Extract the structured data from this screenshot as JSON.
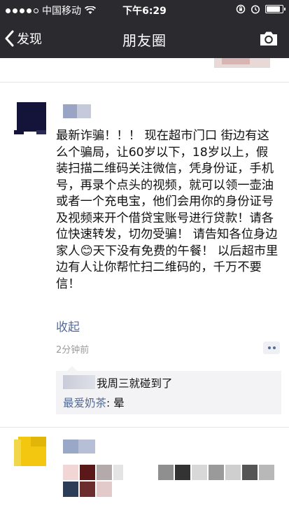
{
  "status_bar": {
    "carrier": "中国移动",
    "time": "下午6:29",
    "signal_dots_filled": 4,
    "signal_dots_total": 5,
    "battery_level": 0.9
  },
  "nav": {
    "back_label": "发现",
    "title": "朋友圈",
    "camera_icon": "camera-icon"
  },
  "post": {
    "text": "最新诈骗！！！ 现在超市门口 街边有这么个骗局，让60岁以下，18岁以上，假装扫描二维码关注微信，凭身份证，手机号，再录个点头的视频，就可以领一壶油或者一个充电宝，他们会用你的身份证号及视频来开个借贷宝账号进行贷款！请各位快速转发，切勿受骗！ 请告知各位身边家人😊天下没有免费的午餐！ 以后超市里边有人让你帮忙扫二维码的，千万不要信！",
    "collapse_label": "收起",
    "time": "2分钟前",
    "comment_icon": "more-icon"
  },
  "comments": [
    {
      "name": "",
      "text": "我周三就碰到了"
    },
    {
      "name": "最爱奶茶",
      "separator": ": ",
      "text": "晕"
    }
  ]
}
